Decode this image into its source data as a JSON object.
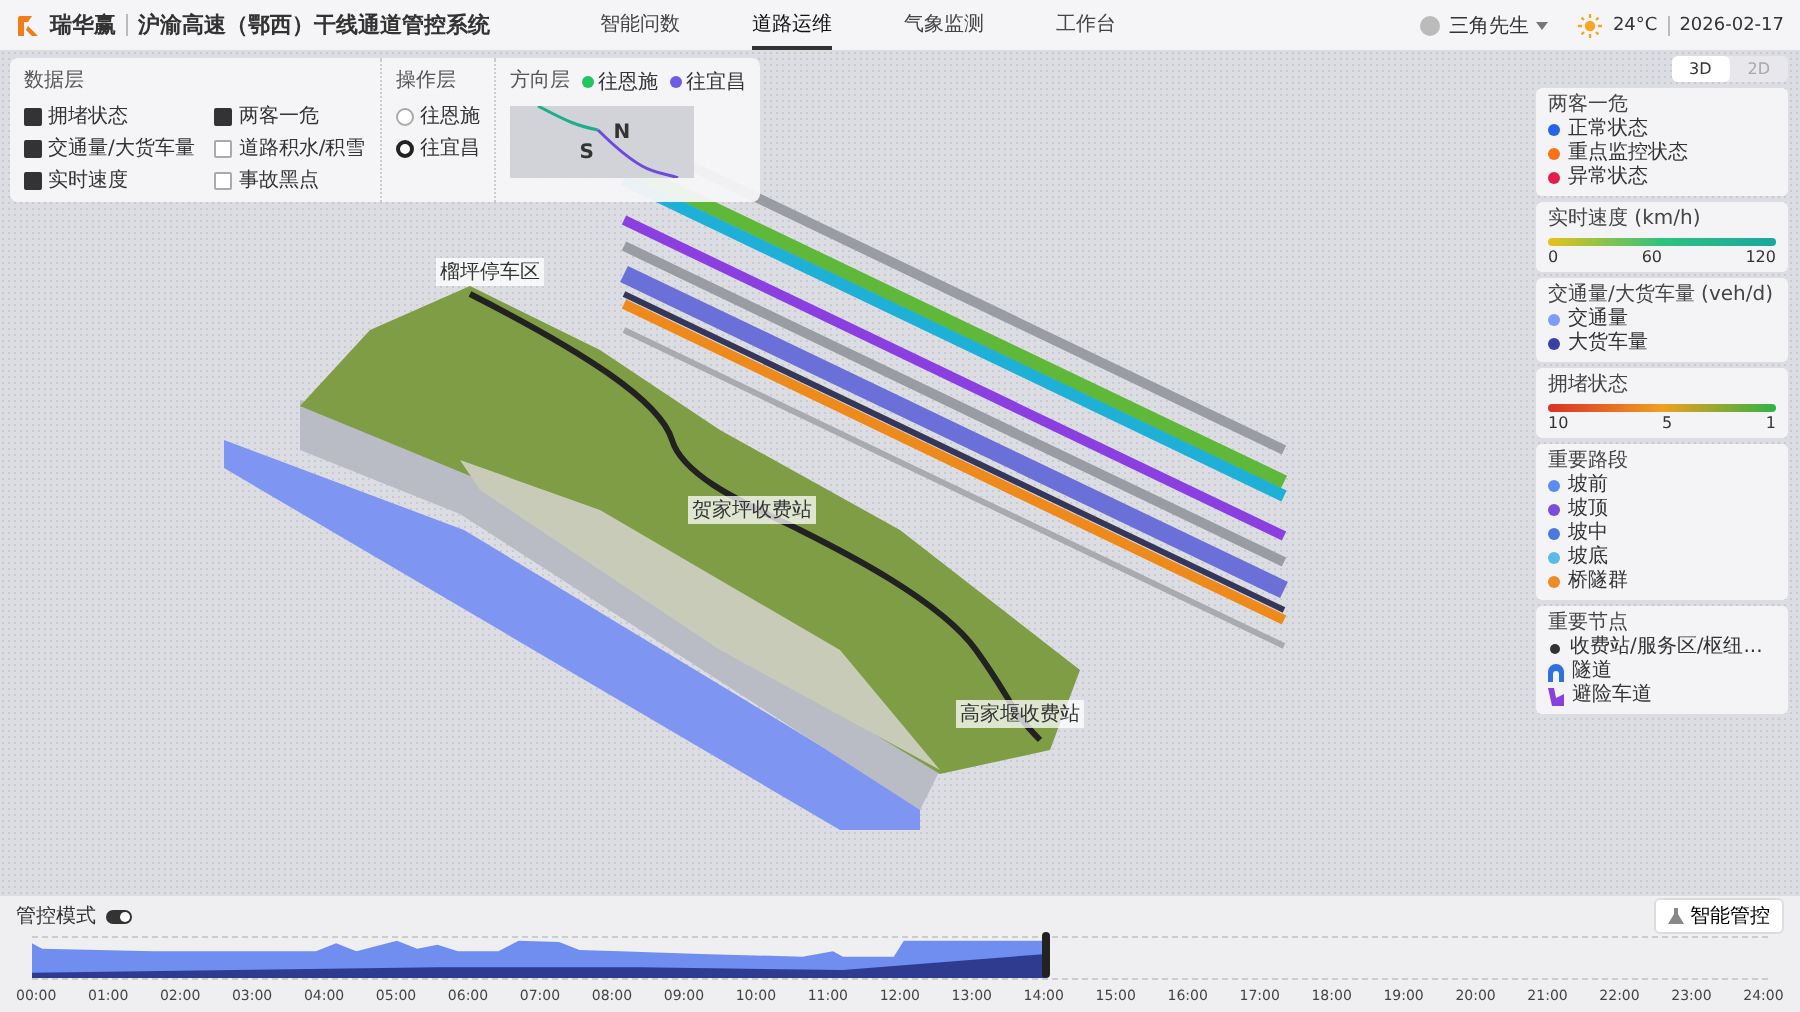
{
  "header": {
    "logo_text": "瑞华赢",
    "title": "沪渝高速（鄂西）干线通道管控系统",
    "nav": [
      {
        "label": "智能问数",
        "selected": false
      },
      {
        "label": "道路运维",
        "selected": true
      },
      {
        "label": "气象监测",
        "selected": false
      },
      {
        "label": "工作台",
        "selected": false
      }
    ],
    "user": "三角先生",
    "temperature": "24°C",
    "date": "2026-02-17"
  },
  "layer_panel": {
    "data_layer": {
      "title": "数据层",
      "items": [
        {
          "label": "拥堵状态",
          "checked": true
        },
        {
          "label": "交通量/大货车量",
          "checked": true
        },
        {
          "label": "实时速度",
          "checked": true
        },
        {
          "label": "两客一危",
          "checked": true
        },
        {
          "label": "道路积水/积雪",
          "checked": false
        },
        {
          "label": "事故黑点",
          "checked": false
        }
      ]
    },
    "operation_layer": {
      "title": "操作层",
      "options": [
        {
          "label": "往恩施",
          "selected": false
        },
        {
          "label": "往宜昌",
          "selected": true
        }
      ]
    },
    "direction_layer": {
      "title": "方向层",
      "legend": [
        {
          "label": "往恩施",
          "color": "#22c55e"
        },
        {
          "label": "往宜昌",
          "color": "#6d5ce7"
        }
      ],
      "compass": [
        "N",
        "S"
      ]
    }
  },
  "view_toggle": [
    {
      "label": "3D",
      "selected": true
    },
    {
      "label": "2D",
      "selected": false
    }
  ],
  "scene": {
    "stations": [
      {
        "label": "榴坪停车区"
      },
      {
        "label": "贺家坪收费站"
      },
      {
        "label": "高家堰收费站"
      }
    ]
  },
  "legends": [
    {
      "kind": "dots",
      "title": "两客一危",
      "items": [
        {
          "label": "正常状态",
          "color": "#2563eb"
        },
        {
          "label": "重点监控状态",
          "color": "#f97316"
        },
        {
          "label": "异常状态",
          "color": "#e11d48"
        }
      ]
    },
    {
      "kind": "speed_scale",
      "title": "实时速度 (km/h)",
      "ticks": [
        "0",
        "60",
        "120"
      ]
    },
    {
      "kind": "dots",
      "title": "交通量/大货车量 (veh/d)",
      "items": [
        {
          "label": "交通量",
          "color": "#7c9cf5"
        },
        {
          "label": "大货车量",
          "color": "#3b3fa8"
        }
      ]
    },
    {
      "kind": "congestion_scale",
      "title": "拥堵状态",
      "ticks": [
        "10",
        "5",
        "1"
      ]
    },
    {
      "kind": "dots",
      "title": "重要路段",
      "items": [
        {
          "label": "坡前",
          "color": "#5b8def"
        },
        {
          "label": "坡顶",
          "color": "#7c4ddb"
        },
        {
          "label": "坡中",
          "color": "#4a7ae0"
        },
        {
          "label": "坡底",
          "color": "#5bbbe8"
        },
        {
          "label": "桥隧群",
          "color": "#f08a24"
        }
      ]
    },
    {
      "kind": "icons",
      "title": "重要节点",
      "items": [
        {
          "label": "收费站/服务区/枢纽...",
          "kind": "node"
        },
        {
          "label": "隧道",
          "kind": "tunnel"
        },
        {
          "label": "避险车道",
          "kind": "escape"
        }
      ]
    }
  ],
  "timeline": {
    "mode_label": "管控模式",
    "mode_on": true,
    "button": "智能管控",
    "level": 0.584,
    "times": [
      "00:00",
      "01:00",
      "02:00",
      "03:00",
      "04:00",
      "05:00",
      "06:00",
      "07:00",
      "08:00",
      "09:00",
      "10:00",
      "11:00",
      "12:00",
      "13:00",
      "14:00",
      "15:00",
      "16:00",
      "17:00",
      "18:00",
      "19:00",
      "20:00",
      "21:00",
      "22:00",
      "23:00",
      "24:00"
    ]
  }
}
